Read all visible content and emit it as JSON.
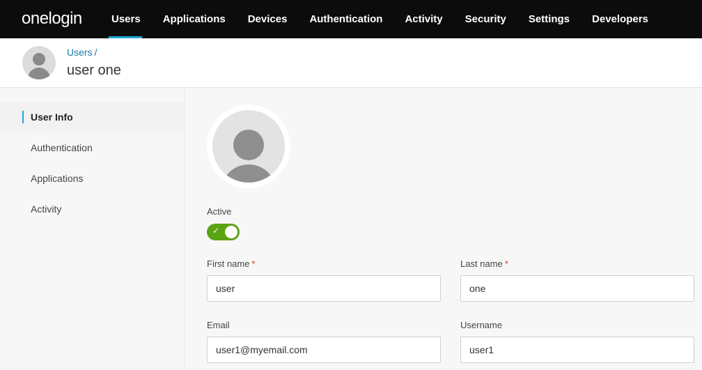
{
  "brand": {
    "logo_text": "onelogin"
  },
  "nav": {
    "items": [
      {
        "label": "Users"
      },
      {
        "label": "Applications"
      },
      {
        "label": "Devices"
      },
      {
        "label": "Authentication"
      },
      {
        "label": "Activity"
      },
      {
        "label": "Security"
      },
      {
        "label": "Settings"
      },
      {
        "label": "Developers"
      }
    ],
    "active": "Users"
  },
  "header": {
    "breadcrumb": "Users",
    "breadcrumb_separator": "/",
    "title": "user one"
  },
  "sidebar": {
    "items": [
      {
        "label": "User Info"
      },
      {
        "label": "Authentication"
      },
      {
        "label": "Applications"
      },
      {
        "label": "Activity"
      }
    ],
    "active": "User Info"
  },
  "form": {
    "active_label": "Active",
    "active_value": true,
    "required_marker": "*",
    "first_name": {
      "label": "First name",
      "value": "user"
    },
    "last_name": {
      "label": "Last name",
      "value": "one"
    },
    "email": {
      "label": "Email",
      "value": "user1@myemail.com"
    },
    "username": {
      "label": "Username",
      "value": "user1"
    }
  },
  "colors": {
    "nav_bg": "#0c0c0c",
    "accent": "#1ea7d8",
    "link": "#1a7ea8",
    "toggle_on": "#5aa412",
    "required": "#d93025"
  },
  "icons": {
    "toggle_check": "✓"
  }
}
